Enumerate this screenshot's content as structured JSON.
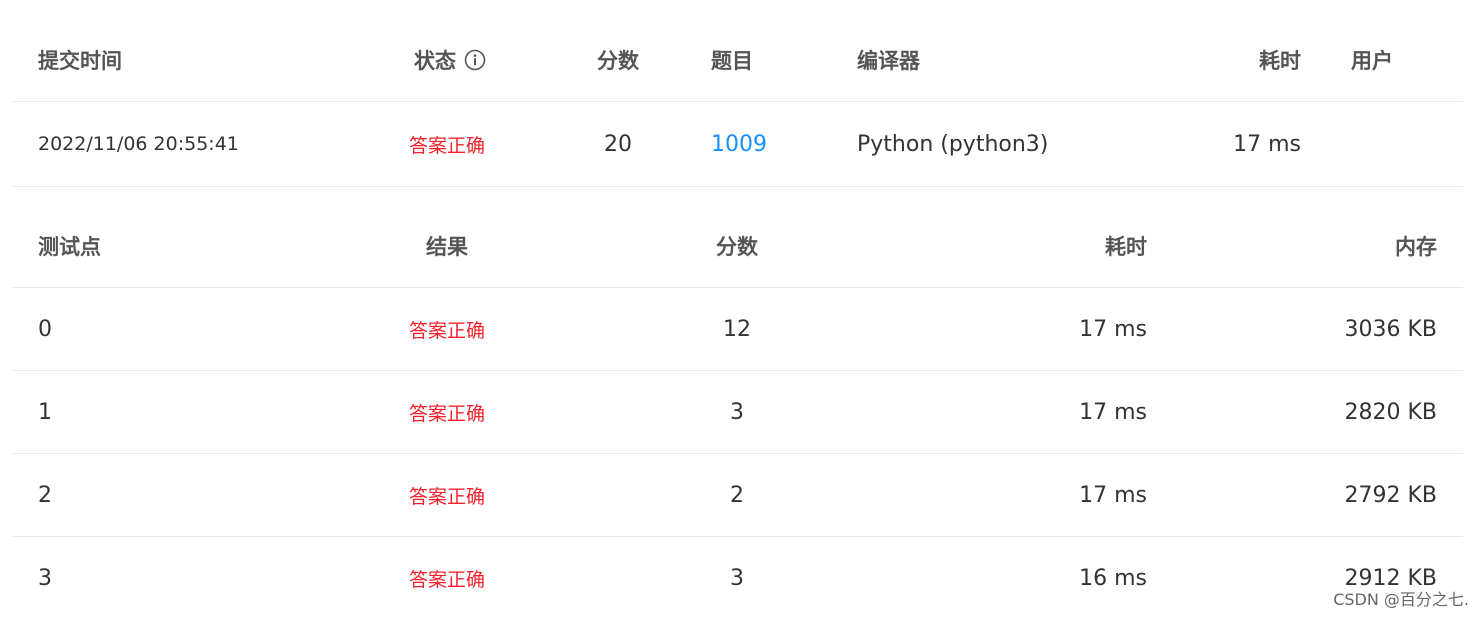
{
  "submission": {
    "headers": {
      "submit_time": "提交时间",
      "status": "状态",
      "score": "分数",
      "problem": "题目",
      "compiler": "编译器",
      "time": "耗时",
      "user": "用户"
    },
    "status_info_icon": "info-circle-icon",
    "row": {
      "submit_time": "2022/11/06 20:55:41",
      "status": "答案正确",
      "score": "20",
      "problem": "1009",
      "compiler": "Python (python3)",
      "time": "17 ms",
      "user": ""
    }
  },
  "tests": {
    "headers": {
      "case": "测试点",
      "result": "结果",
      "score": "分数",
      "time": "耗时",
      "memory": "内存"
    },
    "rows": [
      {
        "case": "0",
        "result": "答案正确",
        "score": "12",
        "time": "17 ms",
        "memory": "3036 KB"
      },
      {
        "case": "1",
        "result": "答案正确",
        "score": "3",
        "time": "17 ms",
        "memory": "2820 KB"
      },
      {
        "case": "2",
        "result": "答案正确",
        "score": "2",
        "time": "17 ms",
        "memory": "2792 KB"
      },
      {
        "case": "3",
        "result": "答案正确",
        "score": "3",
        "time": "16 ms",
        "memory": "2912 KB"
      }
    ]
  },
  "colors": {
    "accepted": "#f5222d",
    "link": "#1890ff",
    "divider": "#e8e8e8"
  },
  "watermark": "CSDN @百分之七."
}
